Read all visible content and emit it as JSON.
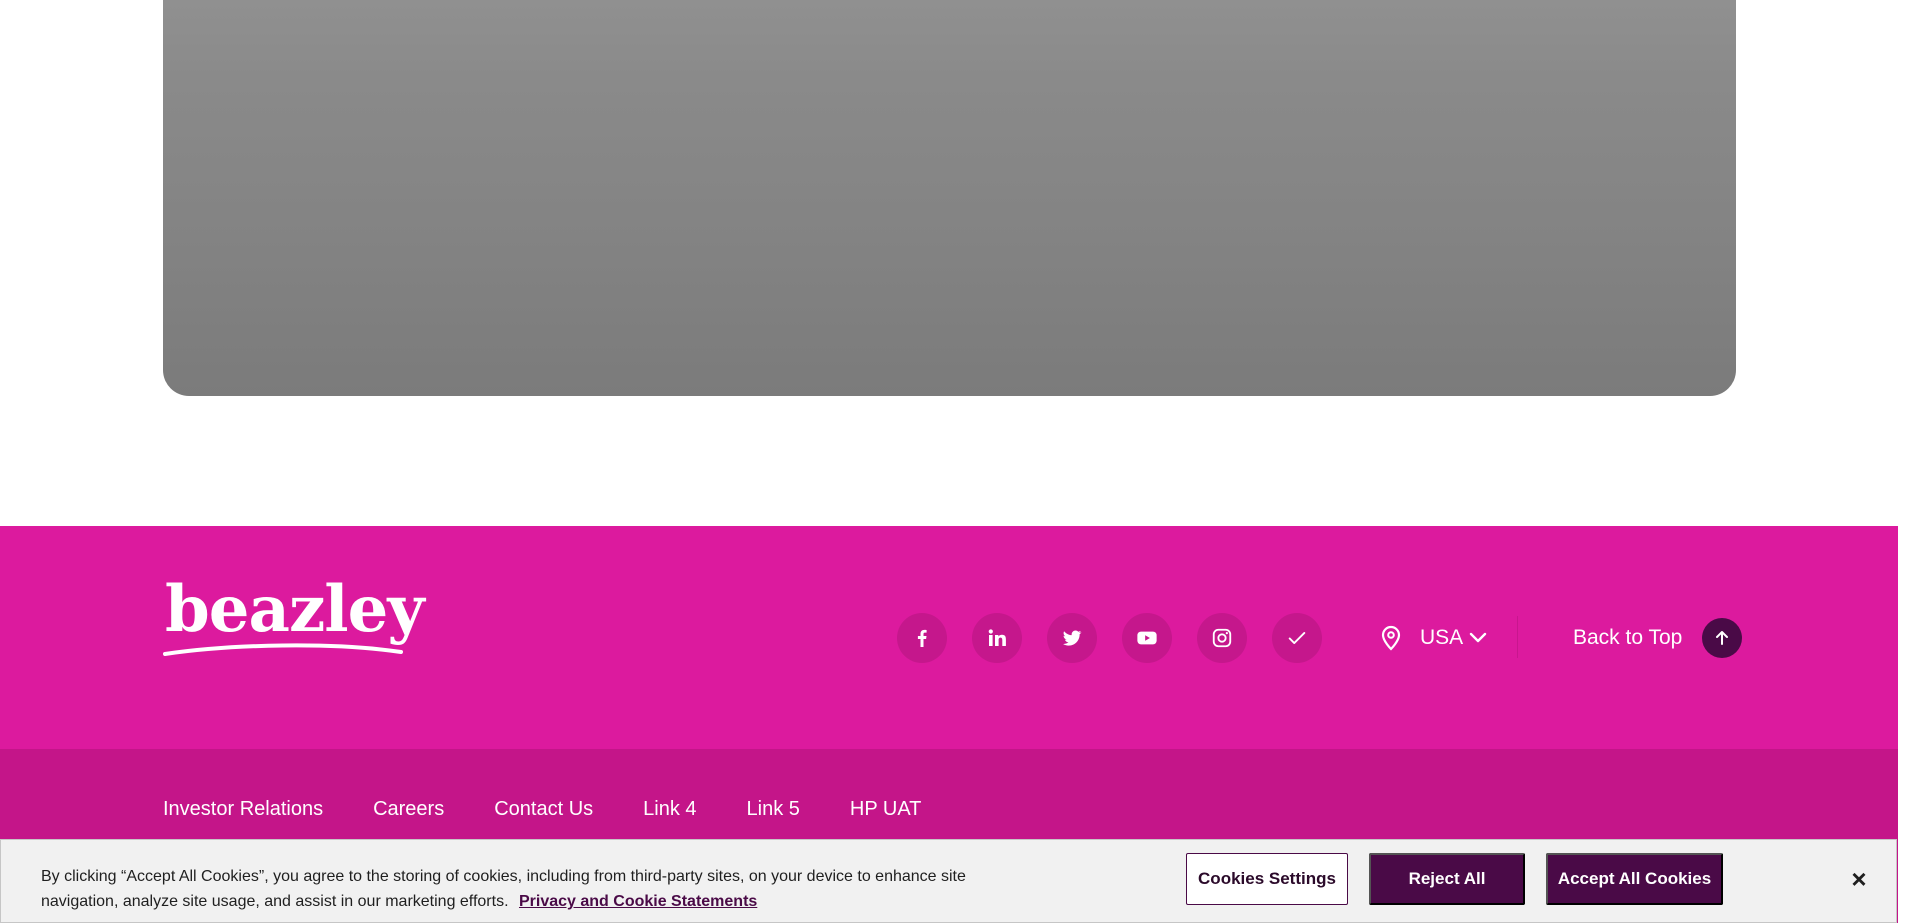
{
  "brand": {
    "logo_text": "beazley",
    "primary_color": "#dc1a9e",
    "dark_color": "#4a0a47"
  },
  "footer": {
    "social": [
      {
        "name": "facebook-icon"
      },
      {
        "name": "linkedin-icon"
      },
      {
        "name": "twitter-icon"
      },
      {
        "name": "youtube-icon"
      },
      {
        "name": "instagram-icon"
      },
      {
        "name": "checkmark-icon"
      }
    ],
    "region": {
      "label": "USA"
    },
    "back_to_top": "Back to Top",
    "links": [
      "Investor Relations",
      "Careers",
      "Contact Us",
      "Link 4",
      "Link 5",
      "HP UAT"
    ]
  },
  "cookie_banner": {
    "text": "By clicking “Accept All Cookies”, you agree to the storing of cookies, including from third-party sites, on your device to enhance site navigation, analyze site usage, and assist in our marketing efforts.",
    "link": "Privacy and Cookie Statements",
    "settings_button": "Cookies Settings",
    "reject_button": "Reject All",
    "accept_button": "Accept All Cookies",
    "close_icon": "×"
  }
}
